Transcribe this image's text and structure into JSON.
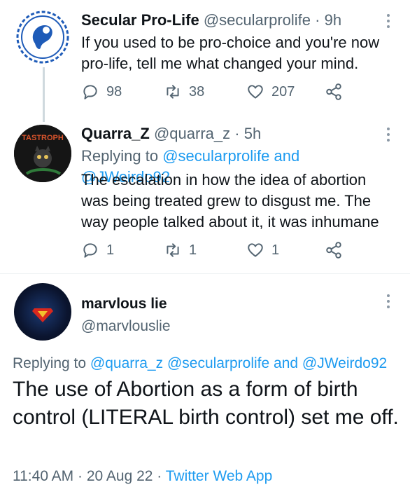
{
  "tweets": [
    {
      "name": "Secular Pro-Life",
      "handle": "@secularprolife",
      "time": "9h",
      "text": "If you used to be pro-choice and you're now pro-life, tell me what changed your mind.",
      "replies": "98",
      "retweets": "38",
      "likes": "207"
    },
    {
      "name": "Quarra_Z",
      "handle": "@quarra_z",
      "time": "5h",
      "avatar_text": "TASTROPH",
      "replying_label": "Replying to",
      "reply_user1": "@secularprolife",
      "reply_and": "and",
      "reply_user2": "@JWeirdo92",
      "text": "The escalation in how the idea of abortion was being treated grew to disgust me. The way people talked about it, it was inhumane",
      "replies": "1",
      "retweets": "1",
      "likes": "1"
    }
  ],
  "main_tweet": {
    "name": "marvlous lie",
    "handle": "@marvlouslie",
    "replying_label": "Replying to",
    "reply_user1": "@quarra_z",
    "reply_user2": "@secularprolife",
    "reply_and": "and",
    "reply_user3": "@JWeirdo92",
    "text": "The use of Abortion as a form of birth control (LITERAL birth control) set me off.",
    "time": "11:40 AM",
    "date": "20 Aug 22",
    "source": "Twitter Web App"
  },
  "colors": {
    "link": "#1d9bf0",
    "muted": "#536471",
    "text": "#0f1419"
  },
  "icons": [
    "reply-icon",
    "retweet-icon",
    "like-icon",
    "share-icon",
    "more-icon"
  ]
}
